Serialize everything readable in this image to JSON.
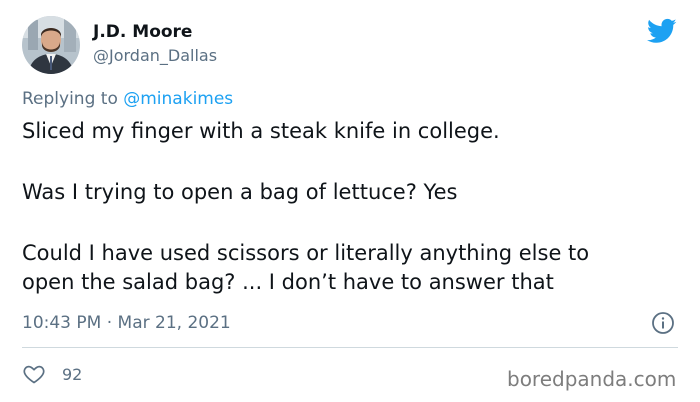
{
  "author": {
    "display_name": "J.D. Moore",
    "handle": "@Jordan_Dallas"
  },
  "reply": {
    "prefix": "Replying to",
    "mention": "@minakimes"
  },
  "tweet": {
    "paragraphs": [
      "Sliced my finger with a steak knife in college.",
      "Was I trying to open a bag of lettuce? Yes",
      "Could I have used scissors or literally anything else to\nopen the salad bag? ... I don’t have to answer that"
    ],
    "timestamp": "10:43 PM · Mar 21, 2021"
  },
  "actions": {
    "like_count": "92"
  },
  "watermark": "boredpanda.com",
  "icons": {
    "brand": "twitter-bird-icon",
    "info": "info-icon",
    "like": "heart-icon"
  },
  "colors": {
    "brand": "#1da1f2",
    "text": "#0f1419",
    "secondary": "#5b7083",
    "divider": "#cfd9de"
  }
}
